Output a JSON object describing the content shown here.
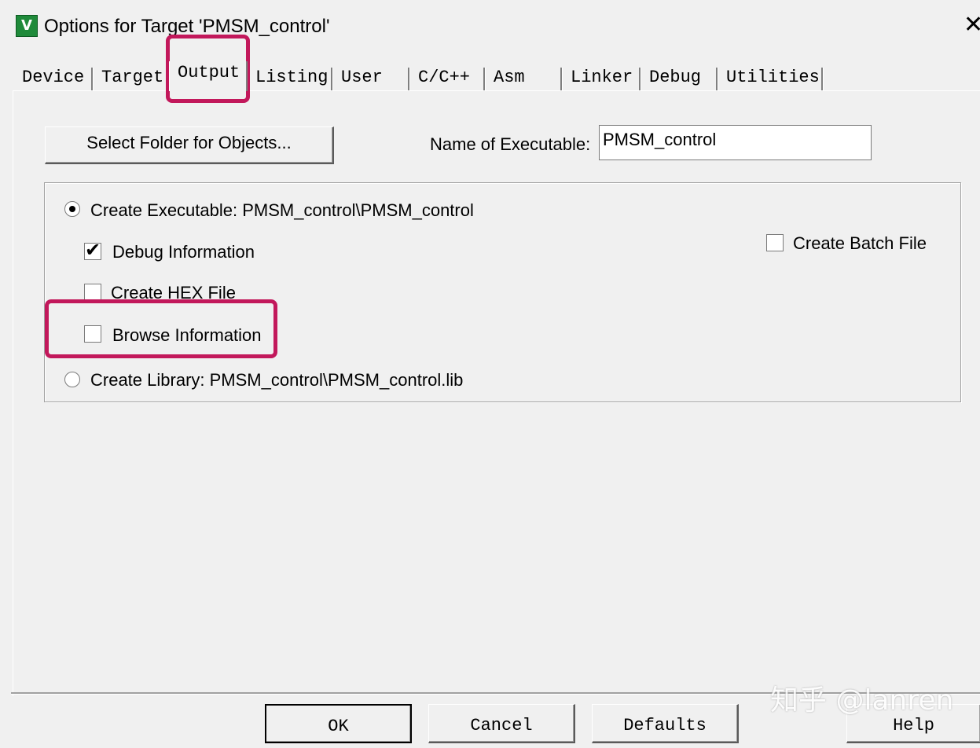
{
  "window": {
    "title": "Options for Target 'PMSM_control'",
    "icon_label": "V",
    "close_glyph": "✕"
  },
  "tabs": [
    {
      "label": "Device"
    },
    {
      "label": "Target"
    },
    {
      "label": "Output",
      "active": true
    },
    {
      "label": "Listing"
    },
    {
      "label": "User"
    },
    {
      "label": "C/C++"
    },
    {
      "label": "Asm"
    },
    {
      "label": "Linker"
    },
    {
      "label": "Debug"
    },
    {
      "label": "Utilities"
    }
  ],
  "output": {
    "select_folder_label": "Select Folder for Objects...",
    "exe_name_label": "Name of Executable:",
    "exe_name_value": "PMSM_control",
    "create_executable_label": "Create Executable:  PMSM_control\\PMSM_control",
    "create_executable_selected": true,
    "debug_info_label": "Debug Information",
    "debug_info_checked": true,
    "hex_file_label": "Create HEX File",
    "hex_file_checked": false,
    "browse_info_label": "Browse Information",
    "browse_info_checked": false,
    "create_library_label": "Create Library:  PMSM_control\\PMSM_control.lib",
    "create_library_selected": false,
    "batch_file_label": "Create Batch File",
    "batch_file_checked": false
  },
  "buttons": {
    "ok": "OK",
    "cancel": "Cancel",
    "defaults": "Defaults",
    "help": "Help"
  },
  "watermark": "知乎 @lanren",
  "colors": {
    "highlight": "#c2185b",
    "background": "#f0f0f0"
  }
}
